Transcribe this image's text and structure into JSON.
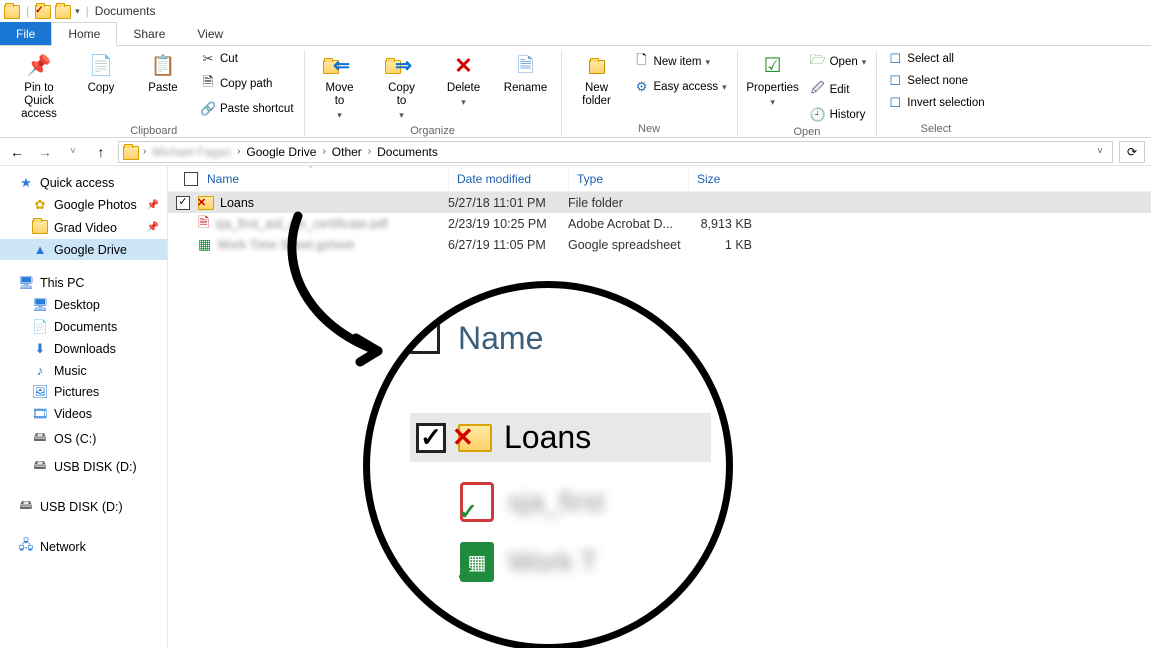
{
  "title": "Documents",
  "tabs": {
    "file": "File",
    "home": "Home",
    "share": "Share",
    "view": "View"
  },
  "ribbon": {
    "clipboard": {
      "label": "Clipboard",
      "pin": "Pin to Quick\naccess",
      "copy": "Copy",
      "paste": "Paste",
      "cut": "Cut",
      "copy_path": "Copy path",
      "paste_shortcut": "Paste shortcut"
    },
    "organize": {
      "label": "Organize",
      "move_to": "Move\nto",
      "copy_to": "Copy\nto",
      "delete": "Delete",
      "rename": "Rename"
    },
    "new": {
      "label": "New",
      "new_folder": "New\nfolder",
      "new_item": "New item",
      "easy_access": "Easy access"
    },
    "open": {
      "label": "Open",
      "properties": "Properties",
      "open": "Open",
      "edit": "Edit",
      "history": "History"
    },
    "select": {
      "label": "Select",
      "select_all": "Select all",
      "select_none": "Select none",
      "invert": "Invert selection"
    }
  },
  "breadcrumb": {
    "user": "Michael Fagan",
    "l2": "Google Drive",
    "l3": "Other",
    "l4": "Documents"
  },
  "sidebar": {
    "quick_access": "Quick access",
    "google_photos": "Google Photos",
    "grad_video": "Grad Video",
    "google_drive": "Google Drive",
    "this_pc": "This PC",
    "desktop": "Desktop",
    "documents": "Documents",
    "downloads": "Downloads",
    "music": "Music",
    "pictures": "Pictures",
    "videos": "Videos",
    "os_c": "OS (C:)",
    "usb1": "USB DISK (D:)",
    "usb2": "USB DISK (D:)",
    "network": "Network"
  },
  "columns": {
    "name": "Name",
    "date": "Date modified",
    "type": "Type",
    "size": "Size"
  },
  "rows": [
    {
      "checked": true,
      "icon": "folder-x",
      "name": "Loans",
      "date": "5/27/18 11:01 PM",
      "type": "File folder",
      "size": ""
    },
    {
      "checked": false,
      "icon": "pdf",
      "name": "sja_first_aid_cpr_certificate.pdf",
      "name_blurred": true,
      "date": "2/23/19 10:25 PM",
      "type": "Adobe Acrobat D...",
      "size": "8,913 KB"
    },
    {
      "checked": false,
      "icon": "sheet",
      "name": "Work Time Sheet.gsheet",
      "name_blurred": true,
      "date": "6/27/19 11:05 PM",
      "type": "Google spreadsheet",
      "size": "1 KB"
    }
  ],
  "zoom": {
    "name_header": "Name",
    "loans": "Loans",
    "blur1": "sja_first",
    "blur2": "Work T"
  }
}
